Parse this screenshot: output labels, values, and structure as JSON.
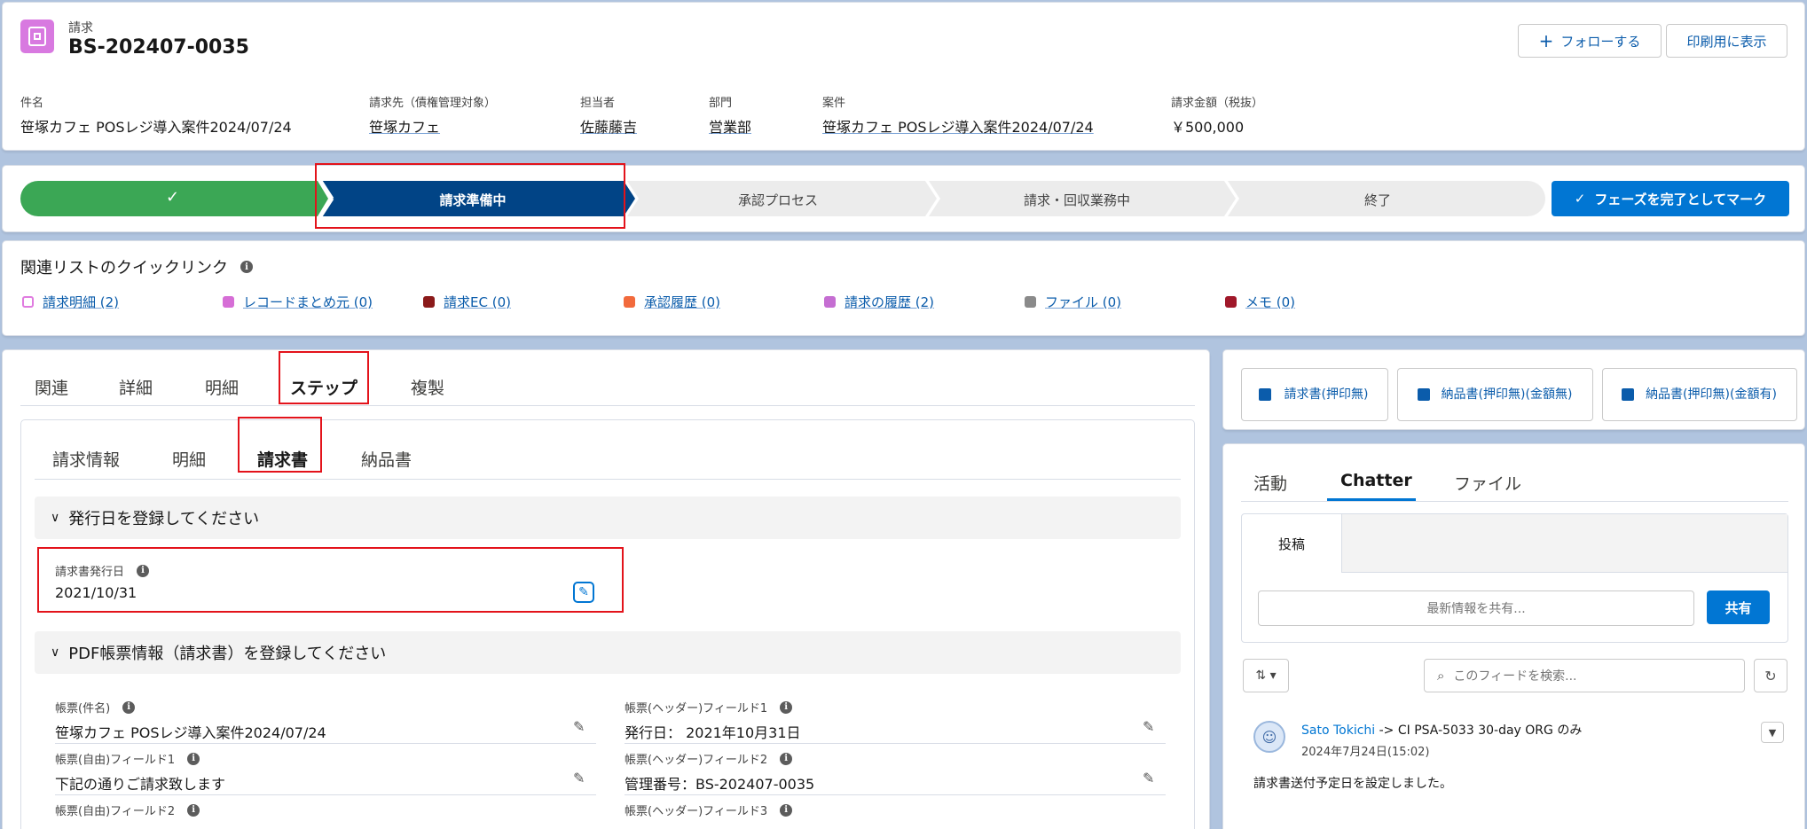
{
  "header": {
    "object_label": "請求",
    "record_name": "BS-202407-0035",
    "follow_button": "フォローする",
    "print_button": "印刷用に表示",
    "fields": [
      {
        "label": "件名",
        "value": "笹塚カフェ POSレジ導入案件2024/07/24"
      },
      {
        "label": "請求先（債権管理対象）",
        "value": "笹塚カフェ"
      },
      {
        "label": "担当者",
        "value": "佐藤藤吉"
      },
      {
        "label": "部門",
        "value": "営業部"
      },
      {
        "label": "案件",
        "value": "笹塚カフェ POSレジ導入案件2024/07/24"
      },
      {
        "label": "請求金額（税抜）",
        "value": "￥500,000"
      }
    ]
  },
  "path": {
    "steps": [
      "✓",
      "請求準備中",
      "承認プロセス",
      "請求・回収業務中",
      "終了"
    ],
    "complete_button": "フェーズを完了としてマーク"
  },
  "quicklinks": {
    "title": "関連リストのクイックリンク",
    "items": [
      {
        "label": "請求明細 (2)",
        "color": "#e07ce0"
      },
      {
        "label": "レコードまとめ元 (0)",
        "color": "#d66ed6"
      },
      {
        "label": "請求EC (0)",
        "color": "#8b1a1a"
      },
      {
        "label": "承認履歴 (0)",
        "color": "#f26a3c"
      },
      {
        "label": "請求の履歴 (2)",
        "color": "#c56ed2"
      },
      {
        "label": "ファイル (0)",
        "color": "#8a8a8a"
      },
      {
        "label": "メモ (0)",
        "color": "#a0182a"
      }
    ]
  },
  "main_tabs": [
    "関連",
    "詳細",
    "明細",
    "ステップ",
    "複製"
  ],
  "sub_tabs": [
    "請求情報",
    "明細",
    "請求書",
    "納品書"
  ],
  "section1": {
    "title": "発行日を登録してください",
    "field_label": "請求書発行日",
    "field_value": "2021/10/31"
  },
  "section2": {
    "title": "PDF帳票情報（請求書）を登録してください",
    "left": [
      {
        "label": "帳票(件名)",
        "value": "笹塚カフェ POSレジ導入案件2024/07/24"
      },
      {
        "label": "帳票(自由)フィールド1",
        "value": "下記の通りご請求致します"
      },
      {
        "label": "帳票(自由)フィールド2",
        "value": ""
      }
    ],
    "right": [
      {
        "label": "帳票(ヘッダー)フィールド1",
        "value": "発行日： 2021年10月31日"
      },
      {
        "label": "帳票(ヘッダー)フィールド2",
        "value": "管理番号：BS-202407-0035"
      },
      {
        "label": "帳票(ヘッダー)フィールド3",
        "value": ""
      }
    ]
  },
  "actions": {
    "buttons": [
      "請求書(押印無)",
      "納品書(押印無)(金額無)",
      "納品書(押印無)(金額有)"
    ]
  },
  "feed": {
    "tabs": [
      "活動",
      "Chatter",
      "ファイル"
    ],
    "post_tab": "投稿",
    "share_placeholder": "最新情報を共有...",
    "share_button": "共有",
    "search_placeholder": "このフィードを検索...",
    "post_author": "Sato Tokichi",
    "post_target": "-> CI PSA-5033 30-day ORG のみ",
    "post_time": "2024年7月24日(15:02)",
    "post_body": "請求書送付予定日を設定しました。"
  },
  "colors": {
    "path_complete": "#3ba755",
    "path_current": "#014486",
    "brand_blue": "#0176d3",
    "highlight_red": "#e3131b"
  }
}
